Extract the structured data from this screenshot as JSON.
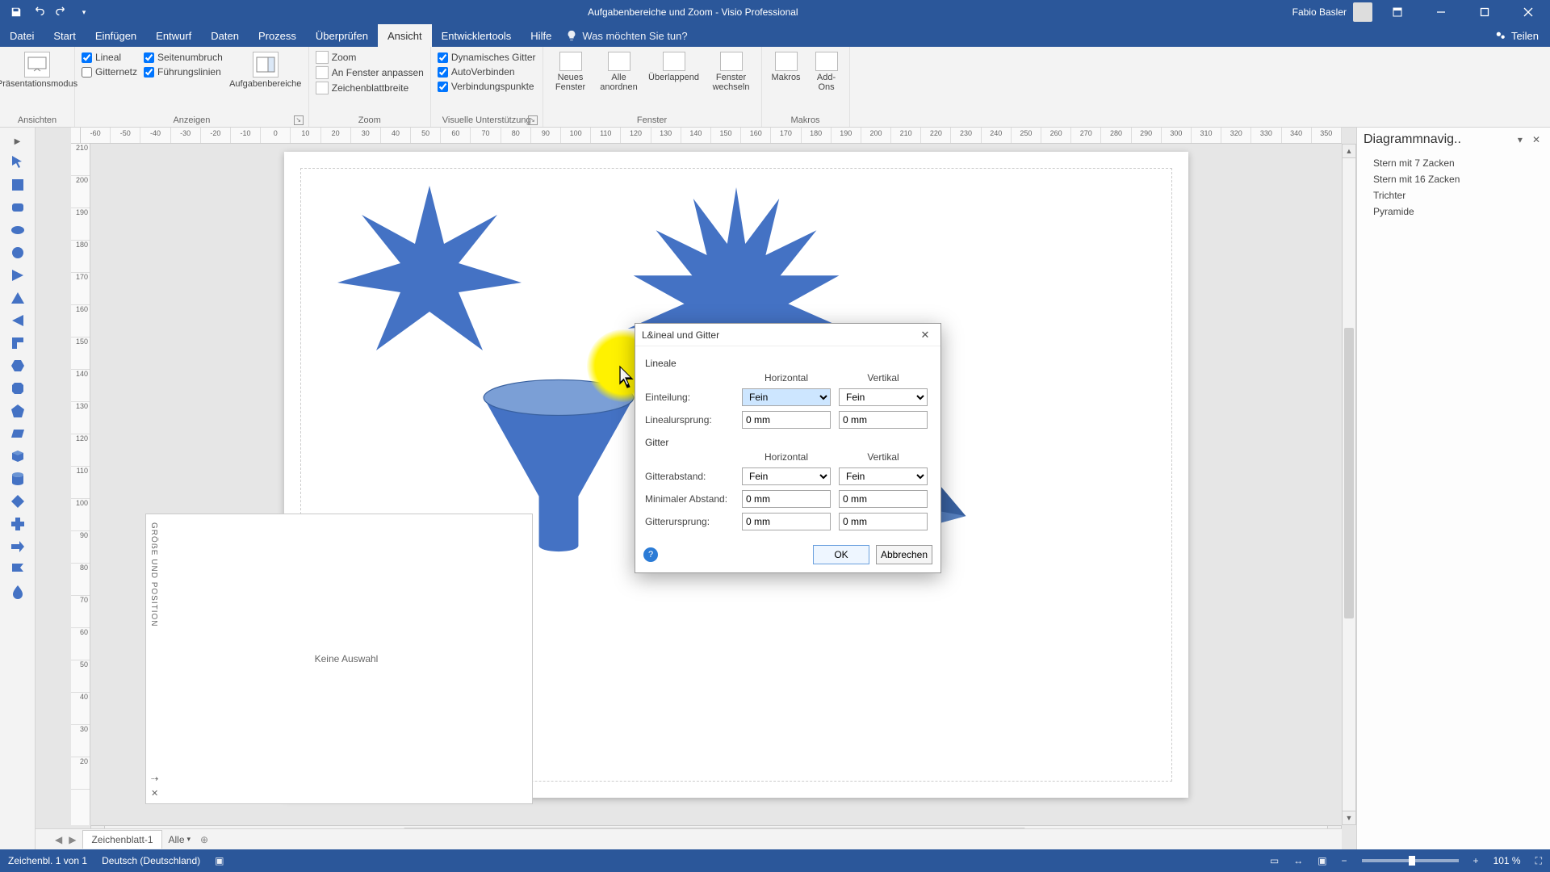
{
  "titlebar": {
    "doc_title": "Aufgabenbereiche und Zoom  -  Visio Professional",
    "user_name": "Fabio Basler"
  },
  "menubar": {
    "tabs": [
      "Datei",
      "Start",
      "Einfügen",
      "Entwurf",
      "Daten",
      "Prozess",
      "Überprüfen",
      "Ansicht",
      "Entwicklertools",
      "Hilfe"
    ],
    "active": "Ansicht",
    "tellme_placeholder": "Was möchten Sie tun?",
    "share": "Teilen"
  },
  "ribbon": {
    "ansichten": {
      "label": "Ansichten",
      "presentation": "Präsentationsmodus"
    },
    "anzeigen": {
      "label": "Anzeigen",
      "lineal": "Lineal",
      "seitenumbruch": "Seitenumbruch",
      "gitternetz": "Gitternetz",
      "fuehrungslinien": "Führungslinien",
      "aufgabenbereiche": "Aufgabenbereiche"
    },
    "zoom": {
      "label": "Zoom",
      "zoom": "Zoom",
      "anfenster": "An Fenster anpassen",
      "zeichenblatt": "Zeichenblattbreite"
    },
    "visuelle": {
      "label": "Visuelle Unterstützung",
      "dyn": "Dynamisches Gitter",
      "auto": "AutoVerbinden",
      "verb": "Verbindungspunkte"
    },
    "fenster": {
      "label": "Fenster",
      "neues": "Neues Fenster",
      "alle": "Alle anordnen",
      "ueber": "Überlappend",
      "wechseln": "Fenster wechseln"
    },
    "makros": {
      "label": "Makros",
      "makros": "Makros",
      "addons": "Add-Ons"
    }
  },
  "hruler_ticks": [
    "-60",
    "-50",
    "-40",
    "-30",
    "-20",
    "-10",
    "0",
    "10",
    "20",
    "30",
    "40",
    "50",
    "60",
    "70",
    "80",
    "90",
    "100",
    "110",
    "120",
    "130",
    "140",
    "150",
    "160",
    "170",
    "180",
    "190",
    "200",
    "210",
    "220",
    "230",
    "240",
    "250",
    "260",
    "270",
    "280",
    "290",
    "300",
    "310",
    "320",
    "330",
    "340",
    "350"
  ],
  "vruler_ticks": [
    "210",
    "200",
    "190",
    "180",
    "170",
    "160",
    "150",
    "140",
    "130",
    "120",
    "110",
    "100",
    "90",
    "80",
    "70",
    "60",
    "50",
    "40",
    "30",
    "20"
  ],
  "sizepos": {
    "title": "GRÖẞE UND POSITION",
    "empty": "Keine Auswahl"
  },
  "nav": {
    "title": "Diagrammnavig..",
    "items": [
      "Stern mit 7 Zacken",
      "Stern mit 16 Zacken",
      "Trichter",
      "Pyramide"
    ]
  },
  "sheets": {
    "active": "Zeichenblatt-1",
    "all": "Alle"
  },
  "status": {
    "page_info": "Zeichenbl. 1 von 1",
    "lang": "Deutsch (Deutschland)",
    "zoom": "101 %"
  },
  "dialog": {
    "title": "L&ineal und Gitter",
    "lineale": "Lineale",
    "gitter": "Gitter",
    "horizontal": "Horizontal",
    "vertikal": "Vertikal",
    "einteilung": "Einteilung:",
    "linealursprung": "Linealursprung:",
    "gitterabstand": "Gitterabstand:",
    "minabstand": "Minimaler Abstand:",
    "gitterursprung": "Gitterursprung:",
    "fein": "Fein",
    "zero": "0 mm",
    "ok": "OK",
    "cancel": "Abbrechen"
  }
}
